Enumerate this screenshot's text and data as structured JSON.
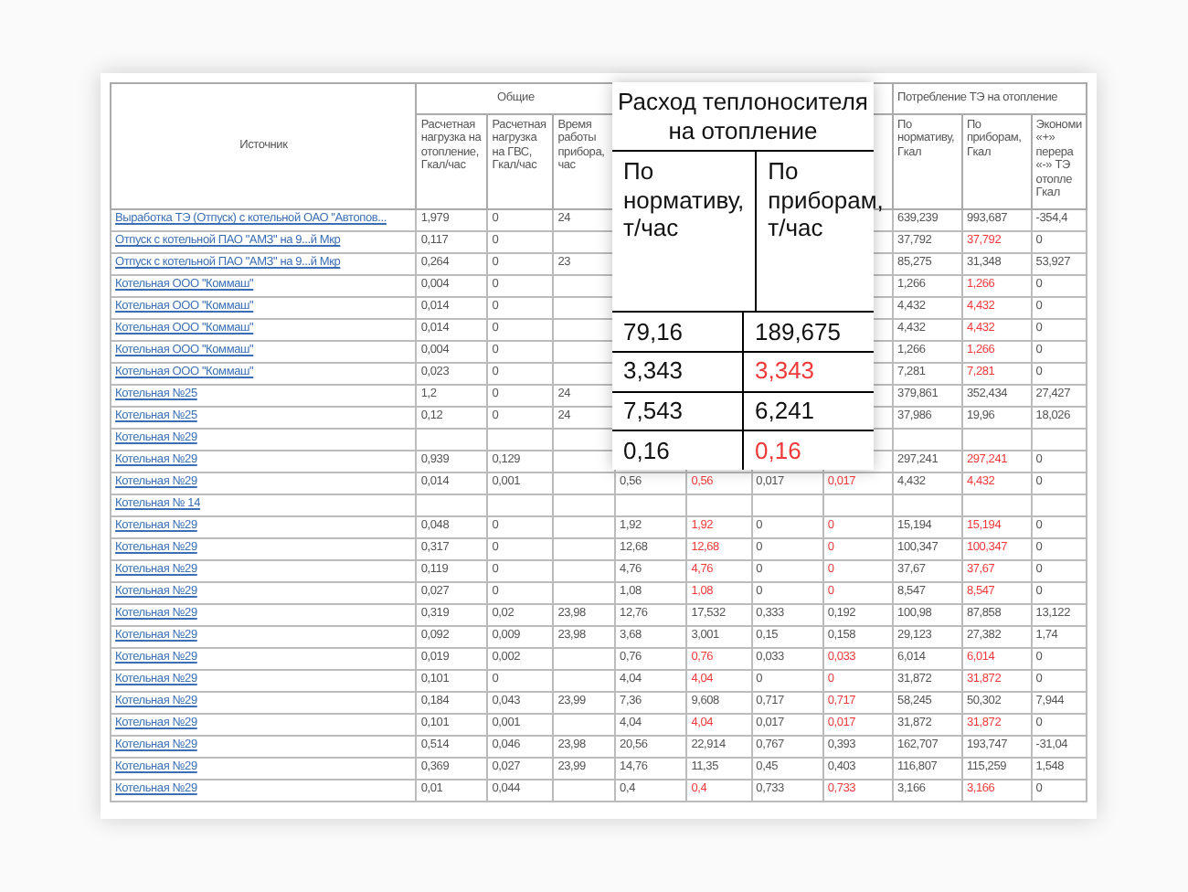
{
  "table": {
    "group_headers": [
      "Общие",
      "Потребление ТЭ на отопление"
    ],
    "source_header": "Источник",
    "columns": [
      "Расчетная нагрузка на отопление, Гкал/час",
      "Расчетная нагрузка на ГВС, Гкал/час",
      "Время работы прибора, час",
      null,
      null,
      null,
      null,
      "По нормативу, Гкал",
      "По приборам, Гкал",
      "Экономи «+» перера «-» ТЭ отопле Гкал"
    ],
    "rows": [
      {
        "source": "Выработка ТЭ (Отпуск) с котельной ОАО \"Автопов...",
        "cells": [
          {
            "text": "1,979",
            "alert": false
          },
          {
            "text": "0",
            "alert": false
          },
          {
            "text": "24",
            "alert": false
          },
          null,
          null,
          null,
          null,
          {
            "text": "639,239",
            "alert": false
          },
          {
            "text": "993,687",
            "alert": false
          },
          {
            "text": "-354,4",
            "alert": false
          }
        ]
      },
      {
        "source": "Отпуск с котельной ПАО \"АМЗ\" на 9...й Мкр",
        "cells": [
          {
            "text": "0,117",
            "alert": false
          },
          {
            "text": "0",
            "alert": false
          },
          null,
          null,
          null,
          null,
          null,
          {
            "text": "37,792",
            "alert": false
          },
          {
            "text": "37,792",
            "alert": true
          },
          {
            "text": "0",
            "alert": false
          }
        ]
      },
      {
        "source": "Отпуск с котельной ПАО \"АМЗ\" на 9...й Мкр",
        "cells": [
          {
            "text": "0,264",
            "alert": false
          },
          {
            "text": "0",
            "alert": false
          },
          {
            "text": "23",
            "alert": false
          },
          null,
          null,
          null,
          null,
          {
            "text": "85,275",
            "alert": false
          },
          {
            "text": "31,348",
            "alert": false
          },
          {
            "text": "53,927",
            "alert": false
          }
        ]
      },
      {
        "source": "Котельная ООО \"Коммаш\"",
        "cells": [
          {
            "text": "0,004",
            "alert": false
          },
          {
            "text": "0",
            "alert": false
          },
          null,
          null,
          null,
          null,
          null,
          {
            "text": "1,266",
            "alert": false
          },
          {
            "text": "1,266",
            "alert": true
          },
          {
            "text": "0",
            "alert": false
          }
        ]
      },
      {
        "source": "Котельная ООО \"Коммаш\"",
        "cells": [
          {
            "text": "0,014",
            "alert": false
          },
          {
            "text": "0",
            "alert": false
          },
          null,
          null,
          null,
          null,
          null,
          {
            "text": "4,432",
            "alert": false
          },
          {
            "text": "4,432",
            "alert": true
          },
          {
            "text": "0",
            "alert": false
          }
        ]
      },
      {
        "source": "Котельная ООО \"Коммаш\"",
        "cells": [
          {
            "text": "0,014",
            "alert": false
          },
          {
            "text": "0",
            "alert": false
          },
          null,
          null,
          null,
          null,
          null,
          {
            "text": "4,432",
            "alert": false
          },
          {
            "text": "4,432",
            "alert": true
          },
          {
            "text": "0",
            "alert": false
          }
        ]
      },
      {
        "source": "Котельная ООО \"Коммаш\"",
        "cells": [
          {
            "text": "0,004",
            "alert": false
          },
          {
            "text": "0",
            "alert": false
          },
          null,
          null,
          null,
          null,
          null,
          {
            "text": "1,266",
            "alert": false
          },
          {
            "text": "1,266",
            "alert": true
          },
          {
            "text": "0",
            "alert": false
          }
        ]
      },
      {
        "source": "Котельная ООО \"Коммаш\"",
        "cells": [
          {
            "text": "0,023",
            "alert": false
          },
          {
            "text": "0",
            "alert": false
          },
          null,
          null,
          null,
          null,
          null,
          {
            "text": "7,281",
            "alert": false
          },
          {
            "text": "7,281",
            "alert": true
          },
          {
            "text": "0",
            "alert": false
          }
        ]
      },
      {
        "source": "Котельная №25",
        "cells": [
          {
            "text": "1,2",
            "alert": false
          },
          {
            "text": "0",
            "alert": false
          },
          {
            "text": "24",
            "alert": false
          },
          null,
          null,
          null,
          null,
          {
            "text": "379,861",
            "alert": false
          },
          {
            "text": "352,434",
            "alert": false
          },
          {
            "text": "27,427",
            "alert": false
          }
        ]
      },
      {
        "source": "Котельная №25",
        "cells": [
          {
            "text": "0,12",
            "alert": false
          },
          {
            "text": "0",
            "alert": false
          },
          {
            "text": "24",
            "alert": false
          },
          null,
          null,
          null,
          null,
          {
            "text": "37,986",
            "alert": false
          },
          {
            "text": "19,96",
            "alert": false
          },
          {
            "text": "18,026",
            "alert": false
          }
        ]
      },
      {
        "source": "Котельная №29",
        "cells": [
          null,
          null,
          null,
          null,
          null,
          null,
          null,
          null,
          null,
          null
        ]
      },
      {
        "source": "Котельная №29",
        "cells": [
          {
            "text": "0,939",
            "alert": false
          },
          {
            "text": "0,129",
            "alert": false
          },
          null,
          null,
          null,
          null,
          null,
          {
            "text": "297,241",
            "alert": false
          },
          {
            "text": "297,241",
            "alert": true
          },
          {
            "text": "0",
            "alert": false
          }
        ]
      },
      {
        "source": "Котельная №29",
        "cells": [
          {
            "text": "0,014",
            "alert": false
          },
          {
            "text": "0,001",
            "alert": false
          },
          null,
          {
            "text": "0,56",
            "alert": false
          },
          {
            "text": "0,56",
            "alert": true
          },
          {
            "text": "0,017",
            "alert": false
          },
          {
            "text": "0,017",
            "alert": true
          },
          {
            "text": "4,432",
            "alert": false
          },
          {
            "text": "4,432",
            "alert": true
          },
          {
            "text": "0",
            "alert": false
          }
        ]
      },
      {
        "source": "Котельная № 14",
        "cells": [
          null,
          null,
          null,
          null,
          null,
          null,
          null,
          null,
          null,
          null
        ]
      },
      {
        "source": "Котельная №29",
        "cells": [
          {
            "text": "0,048",
            "alert": false
          },
          {
            "text": "0",
            "alert": false
          },
          null,
          {
            "text": "1,92",
            "alert": false
          },
          {
            "text": "1,92",
            "alert": true
          },
          {
            "text": "0",
            "alert": false
          },
          {
            "text": "0",
            "alert": true
          },
          {
            "text": "15,194",
            "alert": false
          },
          {
            "text": "15,194",
            "alert": true
          },
          {
            "text": "0",
            "alert": false
          }
        ]
      },
      {
        "source": "Котельная №29",
        "cells": [
          {
            "text": "0,317",
            "alert": false
          },
          {
            "text": "0",
            "alert": false
          },
          null,
          {
            "text": "12,68",
            "alert": false
          },
          {
            "text": "12,68",
            "alert": true
          },
          {
            "text": "0",
            "alert": false
          },
          {
            "text": "0",
            "alert": true
          },
          {
            "text": "100,347",
            "alert": false
          },
          {
            "text": "100,347",
            "alert": true
          },
          {
            "text": "0",
            "alert": false
          }
        ]
      },
      {
        "source": "Котельная №29",
        "cells": [
          {
            "text": "0,119",
            "alert": false
          },
          {
            "text": "0",
            "alert": false
          },
          null,
          {
            "text": "4,76",
            "alert": false
          },
          {
            "text": "4,76",
            "alert": true
          },
          {
            "text": "0",
            "alert": false
          },
          {
            "text": "0",
            "alert": true
          },
          {
            "text": "37,67",
            "alert": false
          },
          {
            "text": "37,67",
            "alert": true
          },
          {
            "text": "0",
            "alert": false
          }
        ]
      },
      {
        "source": "Котельная №29",
        "cells": [
          {
            "text": "0,027",
            "alert": false
          },
          {
            "text": "0",
            "alert": false
          },
          null,
          {
            "text": "1,08",
            "alert": false
          },
          {
            "text": "1,08",
            "alert": true
          },
          {
            "text": "0",
            "alert": false
          },
          {
            "text": "0",
            "alert": true
          },
          {
            "text": "8,547",
            "alert": false
          },
          {
            "text": "8,547",
            "alert": true
          },
          {
            "text": "0",
            "alert": false
          }
        ]
      },
      {
        "source": "Котельная №29",
        "cells": [
          {
            "text": "0,319",
            "alert": false
          },
          {
            "text": "0,02",
            "alert": false
          },
          {
            "text": "23,98",
            "alert": false
          },
          {
            "text": "12,76",
            "alert": false
          },
          {
            "text": "17,532",
            "alert": false
          },
          {
            "text": "0,333",
            "alert": false
          },
          {
            "text": "0,192",
            "alert": false
          },
          {
            "text": "100,98",
            "alert": false
          },
          {
            "text": "87,858",
            "alert": false
          },
          {
            "text": "13,122",
            "alert": false
          }
        ]
      },
      {
        "source": "Котельная №29",
        "cells": [
          {
            "text": "0,092",
            "alert": false
          },
          {
            "text": "0,009",
            "alert": false
          },
          {
            "text": "23,98",
            "alert": false
          },
          {
            "text": "3,68",
            "alert": false
          },
          {
            "text": "3,001",
            "alert": false
          },
          {
            "text": "0,15",
            "alert": false
          },
          {
            "text": "0,158",
            "alert": false
          },
          {
            "text": "29,123",
            "alert": false
          },
          {
            "text": "27,382",
            "alert": false
          },
          {
            "text": "1,74",
            "alert": false
          }
        ]
      },
      {
        "source": "Котельная №29",
        "cells": [
          {
            "text": "0,019",
            "alert": false
          },
          {
            "text": "0,002",
            "alert": false
          },
          null,
          {
            "text": "0,76",
            "alert": false
          },
          {
            "text": "0,76",
            "alert": true
          },
          {
            "text": "0,033",
            "alert": false
          },
          {
            "text": "0,033",
            "alert": true
          },
          {
            "text": "6,014",
            "alert": false
          },
          {
            "text": "6,014",
            "alert": true
          },
          {
            "text": "0",
            "alert": false
          }
        ]
      },
      {
        "source": "Котельная №29",
        "cells": [
          {
            "text": "0,101",
            "alert": false
          },
          {
            "text": "0",
            "alert": false
          },
          null,
          {
            "text": "4,04",
            "alert": false
          },
          {
            "text": "4,04",
            "alert": true
          },
          {
            "text": "0",
            "alert": false
          },
          {
            "text": "0",
            "alert": true
          },
          {
            "text": "31,872",
            "alert": false
          },
          {
            "text": "31,872",
            "alert": true
          },
          {
            "text": "0",
            "alert": false
          }
        ]
      },
      {
        "source": "Котельная №29",
        "cells": [
          {
            "text": "0,184",
            "alert": false
          },
          {
            "text": "0,043",
            "alert": false
          },
          {
            "text": "23,99",
            "alert": false
          },
          {
            "text": "7,36",
            "alert": false
          },
          {
            "text": "9,608",
            "alert": false
          },
          {
            "text": "0,717",
            "alert": false
          },
          {
            "text": "0,717",
            "alert": true
          },
          {
            "text": "58,245",
            "alert": false
          },
          {
            "text": "50,302",
            "alert": false
          },
          {
            "text": "7,944",
            "alert": false
          }
        ]
      },
      {
        "source": "Котельная №29",
        "cells": [
          {
            "text": "0,101",
            "alert": false
          },
          {
            "text": "0,001",
            "alert": false
          },
          null,
          {
            "text": "4,04",
            "alert": false
          },
          {
            "text": "4,04",
            "alert": true
          },
          {
            "text": "0,017",
            "alert": false
          },
          {
            "text": "0,017",
            "alert": true
          },
          {
            "text": "31,872",
            "alert": false
          },
          {
            "text": "31,872",
            "alert": true
          },
          {
            "text": "0",
            "alert": false
          }
        ]
      },
      {
        "source": "Котельная №29",
        "cells": [
          {
            "text": "0,514",
            "alert": false
          },
          {
            "text": "0,046",
            "alert": false
          },
          {
            "text": "23,98",
            "alert": false
          },
          {
            "text": "20,56",
            "alert": false
          },
          {
            "text": "22,914",
            "alert": false
          },
          {
            "text": "0,767",
            "alert": false
          },
          {
            "text": "0,393",
            "alert": false
          },
          {
            "text": "162,707",
            "alert": false
          },
          {
            "text": "193,747",
            "alert": false
          },
          {
            "text": "-31,04",
            "alert": false
          }
        ]
      },
      {
        "source": "Котельная №29",
        "cells": [
          {
            "text": "0,369",
            "alert": false
          },
          {
            "text": "0,027",
            "alert": false
          },
          {
            "text": "23,99",
            "alert": false
          },
          {
            "text": "14,76",
            "alert": false
          },
          {
            "text": "11,35",
            "alert": false
          },
          {
            "text": "0,45",
            "alert": false
          },
          {
            "text": "0,403",
            "alert": false
          },
          {
            "text": "116,807",
            "alert": false
          },
          {
            "text": "115,259",
            "alert": false
          },
          {
            "text": "1,548",
            "alert": false
          }
        ]
      },
      {
        "source": "Котельная №29",
        "cells": [
          {
            "text": "0,01",
            "alert": false
          },
          {
            "text": "0,044",
            "alert": false
          },
          null,
          {
            "text": "0,4",
            "alert": false
          },
          {
            "text": "0,4",
            "alert": true
          },
          {
            "text": "0,733",
            "alert": false
          },
          {
            "text": "0,733",
            "alert": true
          },
          {
            "text": "3,166",
            "alert": false
          },
          {
            "text": "3,166",
            "alert": true
          },
          {
            "text": "0",
            "alert": false
          }
        ]
      }
    ]
  },
  "callout": {
    "title": "Расход теплоносителя на отопление",
    "columns": [
      "По нормативу, т/час",
      "По приборам, т/час"
    ],
    "rows": [
      {
        "cells": [
          {
            "text": "79,16",
            "alert": false
          },
          {
            "text": "189,675",
            "alert": false
          }
        ]
      },
      {
        "cells": [
          {
            "text": "3,343",
            "alert": false
          },
          {
            "text": "3,343",
            "alert": true
          }
        ]
      },
      {
        "cells": [
          {
            "text": "7,543",
            "alert": false
          },
          {
            "text": "6,241",
            "alert": false
          }
        ]
      },
      {
        "cells": [
          {
            "text": "0,16",
            "alert": false
          },
          {
            "text": "0,16",
            "alert": true
          }
        ]
      }
    ]
  }
}
